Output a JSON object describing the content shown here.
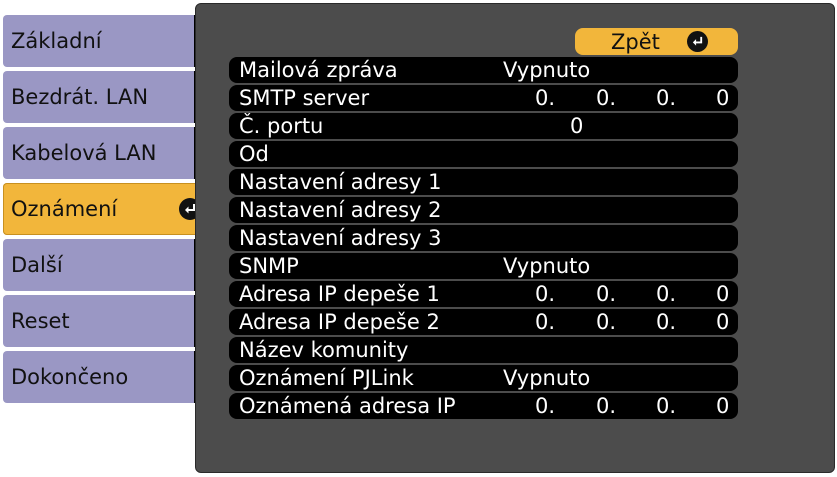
{
  "sidebar": {
    "items": [
      {
        "label": "Základní"
      },
      {
        "label": "Bezdrát. LAN"
      },
      {
        "label": "Kabelová LAN"
      },
      {
        "label": "Oznámení"
      },
      {
        "label": "Další"
      },
      {
        "label": "Reset"
      },
      {
        "label": "Dokončeno"
      }
    ],
    "active_index": 3
  },
  "panel": {
    "back_label": "Zpět",
    "rows": [
      {
        "label": "Mailová zpráva",
        "value": "Vypnuto"
      },
      {
        "label": "SMTP server",
        "ip": [
          "0.",
          "0.",
          "0.",
          "0"
        ]
      },
      {
        "label": "Č. portu",
        "port": "0"
      },
      {
        "label": "Od"
      },
      {
        "label": "Nastavení adresy 1"
      },
      {
        "label": "Nastavení adresy 2"
      },
      {
        "label": "Nastavení adresy 3"
      },
      {
        "label": "SNMP",
        "value": "Vypnuto"
      },
      {
        "label": "Adresa IP depeše 1",
        "ip": [
          "0.",
          "0.",
          "0.",
          "0"
        ]
      },
      {
        "label": "Adresa IP depeše 2",
        "ip": [
          "0.",
          "0.",
          "0.",
          "0"
        ]
      },
      {
        "label": "Název komunity"
      },
      {
        "label": "Oznámení PJLink",
        "value": "Vypnuto"
      },
      {
        "label": "Oznámená adresa IP",
        "ip": [
          "0.",
          "0.",
          "0.",
          "0"
        ]
      }
    ]
  },
  "colors": {
    "sidebar_bg": "#9a97c4",
    "accent": "#f2b63b",
    "panel_bg": "#4c4c4c",
    "row_bg": "#000000"
  },
  "icons": {
    "enter": "enter-return-icon"
  }
}
